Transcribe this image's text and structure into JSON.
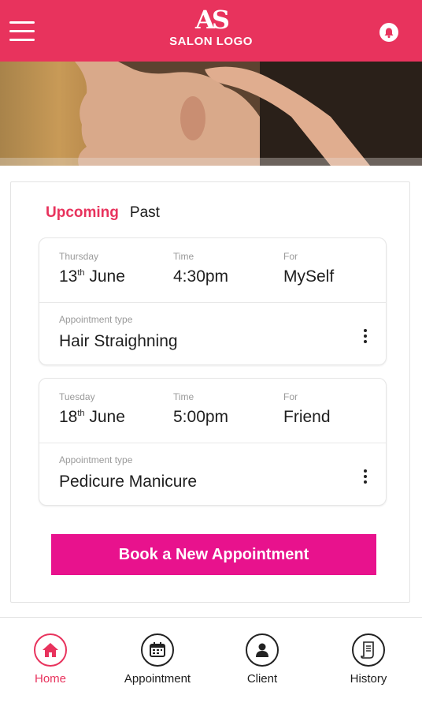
{
  "header": {
    "logo_mark": "AS",
    "logo_text": "SALON LOGO",
    "icons": {
      "menu": "hamburger-menu-icon",
      "notification": "bell-icon"
    },
    "color": "#e8335d"
  },
  "tabs": [
    {
      "label": "Upcoming",
      "active": true
    },
    {
      "label": "Past",
      "active": false
    }
  ],
  "appointments": [
    {
      "day_label": "Thursday",
      "date_num": "13",
      "date_suffix": "th",
      "date_month": " June",
      "time_label": "Time",
      "time": "4:30pm",
      "for_label": "For",
      "for": "MySelf",
      "type_label": "Appointment type",
      "type": "Hair Straighning"
    },
    {
      "day_label": "Tuesday",
      "date_num": "18",
      "date_suffix": "th",
      "date_month": " June",
      "time_label": "Time",
      "time": "5:00pm",
      "for_label": "For",
      "for": "Friend",
      "type_label": "Appointment type",
      "type": "Pedicure Manicure"
    }
  ],
  "book_button": {
    "label": "Book a New Appointment",
    "color": "#e8128d"
  },
  "bottom_nav": [
    {
      "label": "Home",
      "icon": "home-icon",
      "active": true
    },
    {
      "label": "Appointment",
      "icon": "calendar-icon",
      "active": false
    },
    {
      "label": "Client",
      "icon": "user-icon",
      "active": false
    },
    {
      "label": "History",
      "icon": "document-icon",
      "active": false
    }
  ]
}
